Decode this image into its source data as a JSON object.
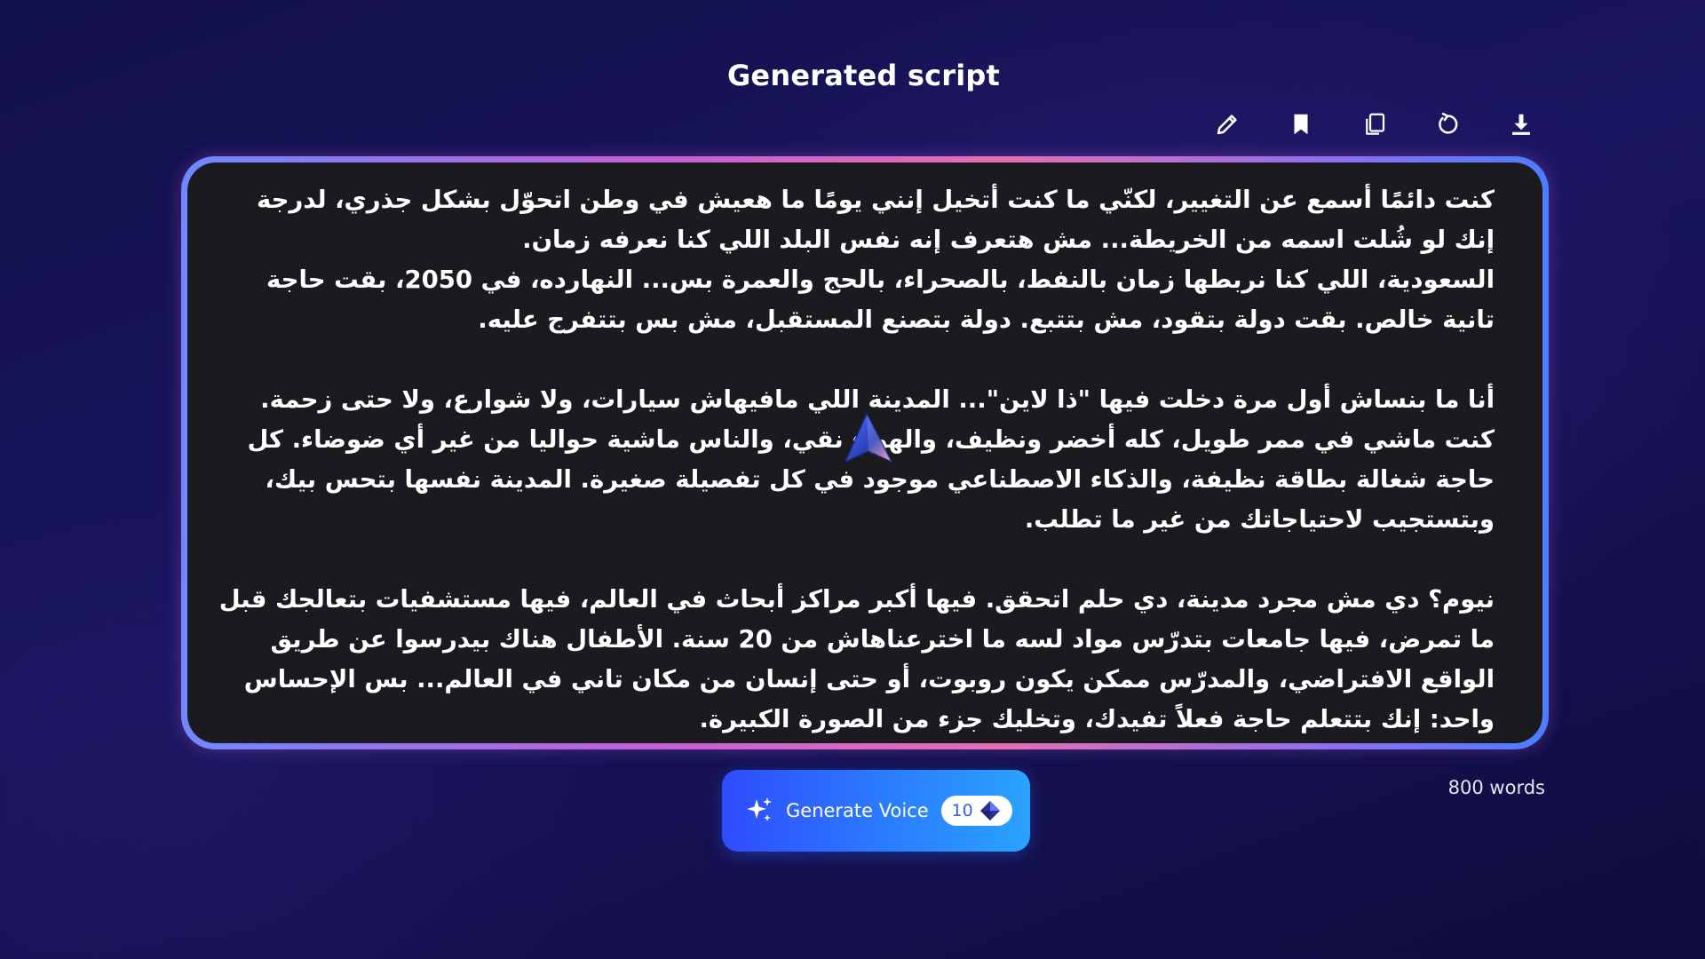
{
  "header": {
    "title": "Generated script"
  },
  "toolbar": {
    "icons": [
      "edit-icon",
      "bookmark-icon",
      "copy-icon",
      "regenerate-icon",
      "download-icon"
    ]
  },
  "script": {
    "paragraphs": [
      "كنت دائمًا أسمع عن التغيير، لكنّي ما كنت أتخيل إنني يومًا ما هعيش في وطن اتحوّل بشكل جذري، لدرجة إنك لو شُلت اسمه من الخريطة... مش هتعرف إنه نفس البلد اللي كنا نعرفه زمان.\nالسعودية، اللي كنا نربطها زمان بالنفط، بالصحراء، بالحج والعمرة بس... النهارده، في 2050، بقت حاجة تانية خالص. بقت دولة بتقود، مش بتتبع. دولة بتصنع المستقبل، مش بس بتتفرج عليه.",
      "أنا ما بنساش أول مرة دخلت فيها \"ذا لاين\"... المدينة اللي مافيهاش سيارات، ولا شوارع، ولا حتى زحمة. كنت ماشي في ممر طويل، كله أخضر ونظيف، والهواء نقي، والناس ماشية حواليا من غير أي ضوضاء. كل حاجة شغالة بطاقة نظيفة، والذكاء الاصطناعي موجود في كل تفصيلة صغيرة. المدينة نفسها بتحس بيك، وبتستجيب لاحتياجاتك من غير ما تطلب.",
      "نيوم؟ دي مش مجرد مدينة، دي حلم اتحقق. فيها أكبر مراكز أبحاث في العالم، فيها مستشفيات بتعالجك قبل ما تمرض، فيها جامعات بتدرّس مواد لسه ما اخترعناهاش من 20 سنة. الأطفال هناك بيدرسوا عن طريق الواقع الافتراضي، والمدرّس ممكن يكون روبوت، أو حتى إنسان من مكان تاني في العالم... بس الإحساس واحد: إنك بتتعلم حاجة فعلاً تفيدك، وتخليك جزء من الصورة الكبيرة."
    ]
  },
  "generate": {
    "label": "Generate Voice",
    "credits": "10",
    "icon": "sparkle-icon",
    "credit_icon": "diamond-icon"
  },
  "stats": {
    "word_count": "800 words"
  },
  "colors": {
    "background": "#14104d",
    "panel": "#1b1b1f",
    "button": "#2b7dff"
  }
}
